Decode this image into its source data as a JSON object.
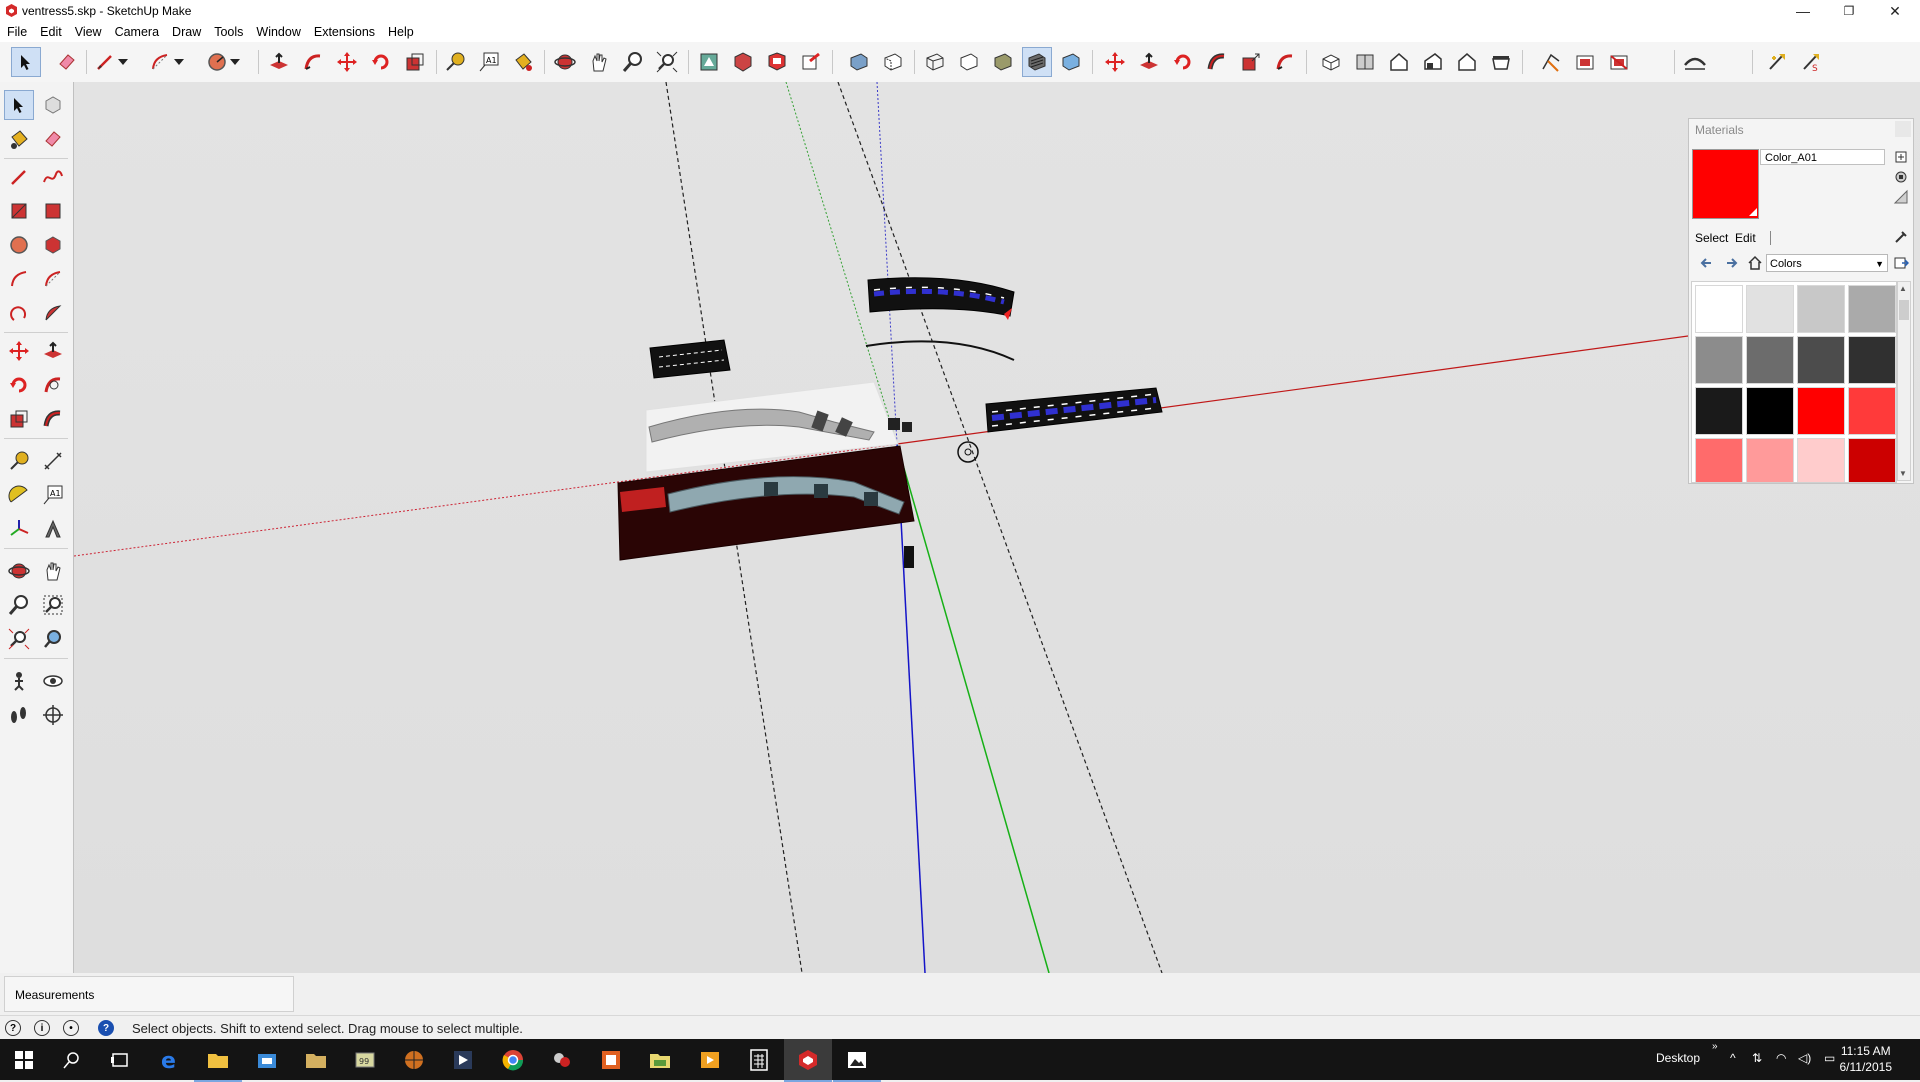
{
  "window": {
    "title": "ventress5.skp - SketchUp Make",
    "controls": {
      "minimize": "—",
      "maximize": "❐",
      "close": "✕"
    }
  },
  "menu": {
    "items": [
      "File",
      "Edit",
      "View",
      "Camera",
      "Draw",
      "Tools",
      "Window",
      "Extensions",
      "Help"
    ]
  },
  "toolbar": {
    "tools": [
      "select-icon",
      "eraser-icon",
      "line-icon",
      "line-dropdown-icon",
      "arc-icon",
      "arc-dropdown-icon",
      "circle-icon",
      "circle-dropdown-icon",
      "push-pull-icon",
      "follow-me-icon",
      "move-icon",
      "rotate-icon",
      "scale-icon",
      "tape-measure-icon",
      "text-icon",
      "paint-bucket-icon",
      "orbit-icon",
      "pan-icon",
      "zoom-icon",
      "zoom-extents-icon",
      "3d-warehouse-icon",
      "extension-warehouse-icon",
      "layout-icon",
      "share-model-icon",
      "xray-icon",
      "back-edges-icon",
      "wireframe-icon",
      "hidden-line-icon",
      "shaded-icon",
      "shaded-textures-icon",
      "monochrome-icon",
      "move-sandbox-icon",
      "push-pull-sandbox-icon",
      "rotate-sandbox-icon",
      "offset-icon",
      "scale-sandbox-icon",
      "follow-sandbox-icon",
      "iso-view-icon",
      "top-view-icon",
      "front-view-icon",
      "right-view-icon",
      "back-view-icon",
      "left-view-icon",
      "section-plane-icon",
      "display-section-icon",
      "section-fill-icon",
      "sandbox-icon",
      "solid-tools-icon",
      "dynamic-components-icon"
    ]
  },
  "left_tools": [
    "select-icon",
    "component-icon",
    "paint-bucket-icon",
    "eraser-icon",
    "line-icon",
    "freehand-icon",
    "rectangle-icon",
    "rotated-rectangle-icon",
    "circle-icon",
    "polygon-icon",
    "arc-icon",
    "two-point-arc-icon",
    "three-point-arc-icon",
    "pie-icon",
    "move-icon",
    "push-pull-icon",
    "rotate-icon",
    "follow-me-icon",
    "scale-icon",
    "offset-icon",
    "tape-measure-icon",
    "dimension-icon",
    "protractor-icon",
    "text-icon",
    "axes-icon",
    "3d-text-icon",
    "orbit-icon",
    "pan-icon",
    "zoom-icon",
    "zoom-window-icon",
    "zoom-extents-icon",
    "previous-view-icon",
    "walk-icon",
    "look-around-icon",
    "position-camera-icon",
    "section-plane-icon"
  ],
  "materials": {
    "title": "Materials",
    "current_name": "Color_A01",
    "current_color": "#ff0000",
    "tabs": [
      "Select",
      "Edit"
    ],
    "library": "Colors",
    "swatches": [
      "#ffffff",
      "#e1e1e1",
      "#c8c8c8",
      "#aaaaaa",
      "#8c8c8c",
      "#6c6c6c",
      "#4c4c4c",
      "#303030",
      "#1a1a1a",
      "#000000",
      "#ff0000",
      "#ff3a3a",
      "#ff6b6b",
      "#ff9a9a",
      "#ffcccc",
      "#cc0000"
    ]
  },
  "measurements": {
    "label": "Measurements",
    "value": ""
  },
  "status": {
    "text": "Select objects. Shift to extend select. Drag mouse to select multiple."
  },
  "taskbar": {
    "apps": [
      "start-icon",
      "search-icon",
      "task-view-icon",
      "edge-icon",
      "file-explorer-icon",
      "store-icon",
      "folder-icon",
      "game-icon",
      "basketball-icon",
      "media-icon",
      "chrome-icon",
      "puzzle-icon",
      "office-icon",
      "folder-green-icon",
      "video-icon",
      "calculator-icon",
      "sketchup-icon",
      "photos-icon"
    ],
    "desktop_label": "Desktop",
    "time": "11:15 AM",
    "date": "6/11/2015"
  }
}
